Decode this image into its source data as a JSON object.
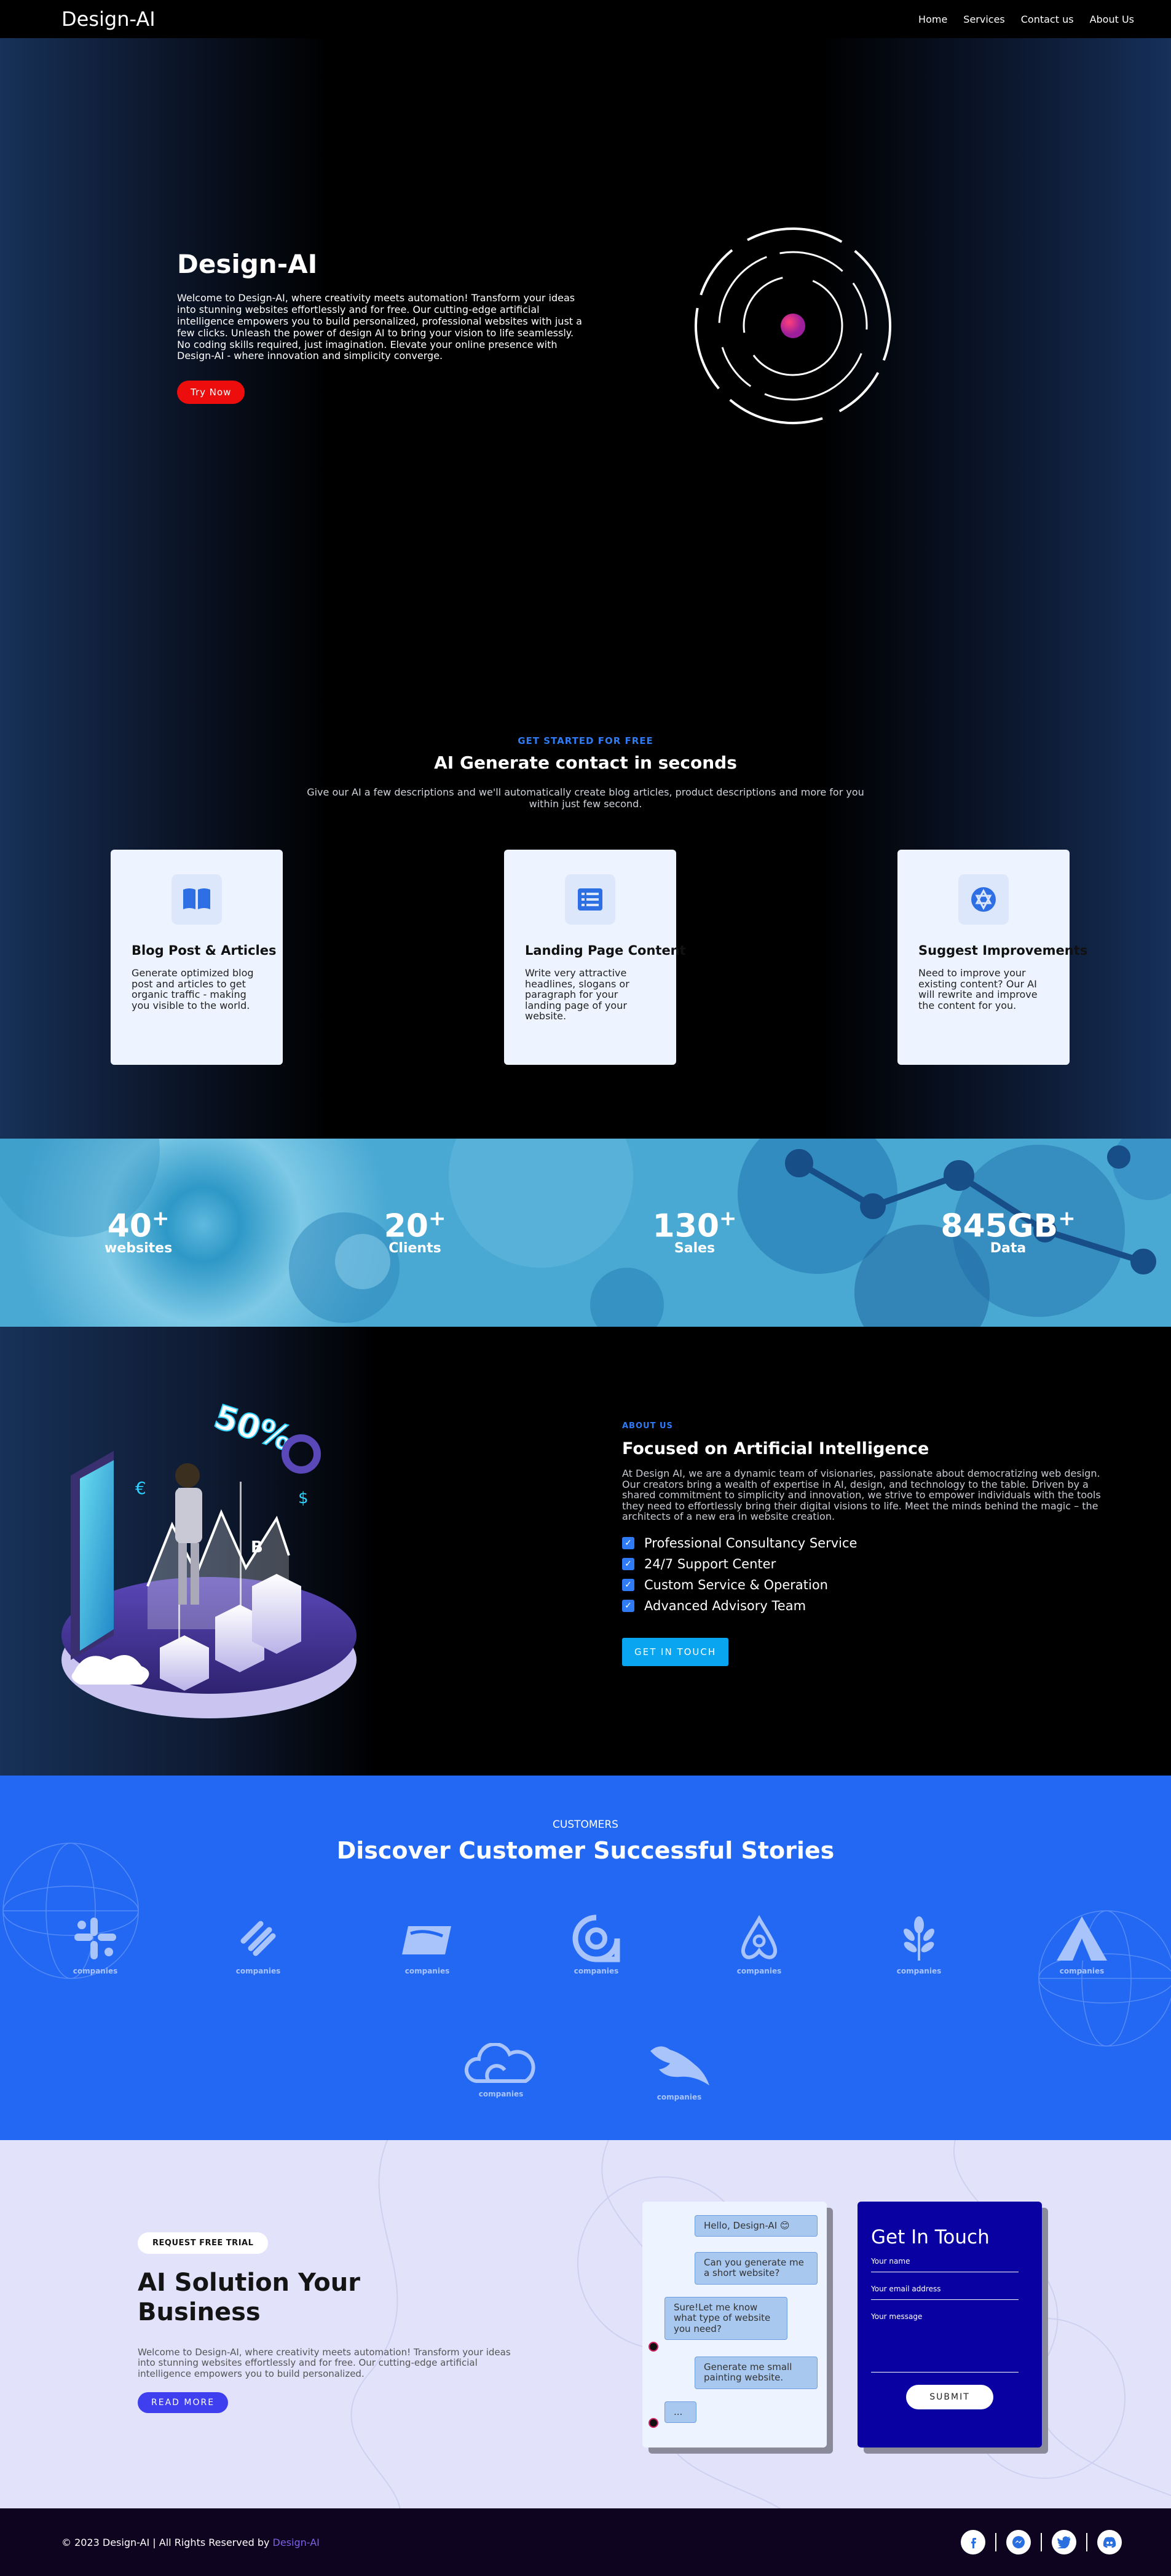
{
  "nav": {
    "logo": "Design-AI",
    "items": [
      "Home",
      "Services",
      "Contact us",
      "About Us"
    ]
  },
  "hero": {
    "title": "Design-AI",
    "text": "Welcome to Design-AI, where creativity meets automation! Transform your ideas into stunning websites effortlessly and for free. Our cutting-edge artificial intelligence empowers you to build personalized, professional websites with just a few clicks. Unleash the power of design AI to bring your vision to life seamlessly. No coding skills required, just imagination. Elevate your online presence with Design-AI - where innovation and simplicity converge.",
    "button": "Try Now"
  },
  "services": {
    "eyebrow": "GET STARTED FOR FREE",
    "title": "AI Generate contact in seconds",
    "subtitle": "Give our AI a few descriptions and we'll automatically create blog articles, product descriptions and more for you within just few second.",
    "cards": [
      {
        "icon": "book-icon",
        "title": "Blog Post & Articles",
        "text": "Generate optimized blog post and articles to get organic traffic - making you visible to the world."
      },
      {
        "icon": "list-icon",
        "title": "Landing Page Content",
        "text": "Write very attractive headlines, slogans or paragraph for your landing page of your website."
      },
      {
        "icon": "star-of-david-icon",
        "title": "Suggest Improvements",
        "text": "Need to improve your existing content? Our AI will rewrite and improve the content for you."
      }
    ]
  },
  "stats": [
    {
      "num": "40",
      "sup": "+",
      "label": "websites"
    },
    {
      "num": "20",
      "sup": "+",
      "label": "Clients"
    },
    {
      "num": "130",
      "sup": "+",
      "label": "Sales"
    },
    {
      "num": "845GB",
      "sup": "+",
      "label": "Data"
    }
  ],
  "about": {
    "eyebrow": "ABOUT US",
    "title": "Focused on Artificial Intelligence",
    "text": "At Design AI, we are a dynamic team of visionaries, passionate about democratizing web design. Our creators bring a wealth of expertise in AI, design, and technology to the table. Driven by a shared commitment to simplicity and innovation, we strive to empower individuals with the tools they need to effortlessly bring their digital visions to life. Meet the minds behind the magic – the architects of a new era in website creation.",
    "items": [
      "Professional Consultancy Service",
      "24/7 Support Center",
      "Custom Service & Operation",
      "Advanced Advisory Team"
    ],
    "button": "GET IN TOUCH",
    "overlay": {
      "percent": "50%",
      "currency_symbols": [
        "€",
        "$",
        "B"
      ]
    }
  },
  "customers": {
    "eyebrow": "CUSTOMERS",
    "title": "Discover Customer Successful Stories",
    "logos": [
      {
        "icon": "slack-icon",
        "caption": "companies"
      },
      {
        "icon": "squarespace-icon",
        "caption": "companies"
      },
      {
        "icon": "usps-icon",
        "caption": "companies"
      },
      {
        "icon": "quora-icon",
        "caption": "companies"
      },
      {
        "icon": "airbnb-icon",
        "caption": "companies"
      },
      {
        "icon": "leaf-icon",
        "caption": "companies"
      },
      {
        "icon": "triangle-icon",
        "caption": "companies"
      },
      {
        "icon": "cloud-icon",
        "caption": "companies"
      },
      {
        "icon": "bird-icon",
        "caption": "companies"
      }
    ]
  },
  "cta": {
    "pill": "REQUEST FREE TRIAL",
    "title": "AI Solution Your Business",
    "text": "Welcome to Design-AI, where creativity meets automation! Transform your ideas into stunning websites effortlessly and for free. Our cutting-edge artificial intelligence empowers you to build personalized.",
    "button": "READ MORE",
    "chat": [
      "Hello, Design-AI 😊",
      "Can you generate me a short website?",
      "Sure!Let me know what type of website you need?",
      "Generate me small painting website.",
      "..."
    ]
  },
  "form": {
    "title": "Get In Touch",
    "name": "Your name",
    "email": "Your email address",
    "message": "Your message",
    "submit": "SUBMIT"
  },
  "footer": {
    "copy": "© 2023 Design-AI | All Rights Reserved by ",
    "brand": "Design-AI",
    "socials": [
      "facebook-icon",
      "messenger-icon",
      "twitter-icon",
      "discord-icon"
    ]
  },
  "colors": {
    "accent": "#2f7bf5",
    "cta_red": "#ee0d0d",
    "customers_bg": "#2368f2",
    "form_bg": "#0a01a3",
    "footer_bg": "#0e0420"
  }
}
